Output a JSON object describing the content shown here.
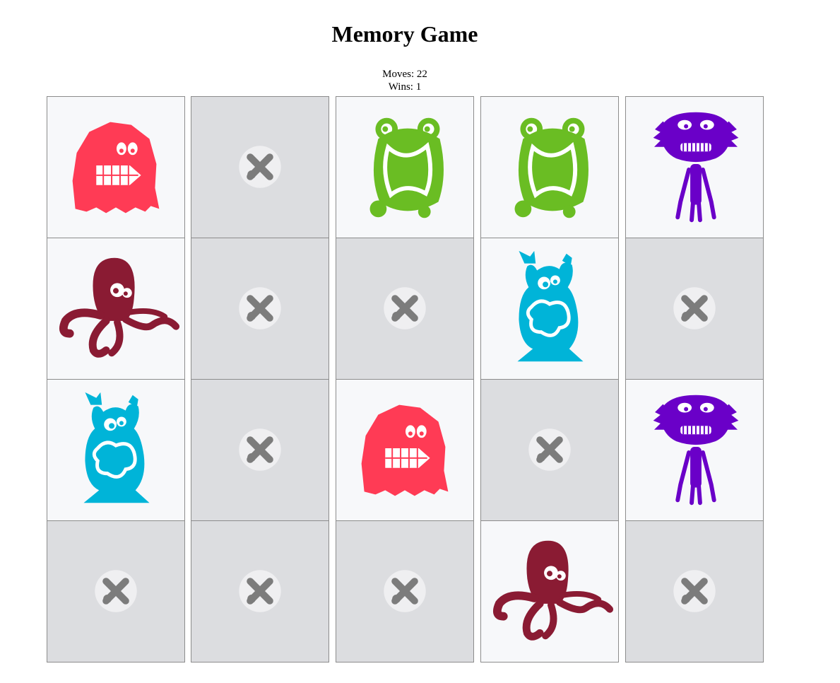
{
  "game": {
    "title": "Memory Game",
    "moves_label": "Moves: 22",
    "wins_label": "Wins: 1"
  },
  "board": {
    "rows": 4,
    "cols": 5,
    "cards": [
      {
        "state": "face-up",
        "monster": "red-furry-monster",
        "color": "#ff3b55"
      },
      {
        "state": "face-down",
        "monster": "card-back",
        "color": "#7c7c7c"
      },
      {
        "state": "face-up",
        "monster": "green-frog-monster",
        "color": "#6abd23"
      },
      {
        "state": "face-up",
        "monster": "green-frog-monster",
        "color": "#6abd23"
      },
      {
        "state": "face-up",
        "monster": "purple-alien-monster",
        "color": "#6a00c8"
      },
      {
        "state": "face-up",
        "monster": "maroon-octopus-monster",
        "color": "#8a1b33"
      },
      {
        "state": "face-down",
        "monster": "card-back",
        "color": "#7c7c7c"
      },
      {
        "state": "face-down",
        "monster": "card-back",
        "color": "#7c7c7c"
      },
      {
        "state": "face-up",
        "monster": "blue-horned-monster",
        "color": "#00b4d8"
      },
      {
        "state": "face-down",
        "monster": "card-back",
        "color": "#7c7c7c"
      },
      {
        "state": "face-up",
        "monster": "blue-horned-monster",
        "color": "#00b4d8"
      },
      {
        "state": "face-down",
        "monster": "card-back",
        "color": "#7c7c7c"
      },
      {
        "state": "face-up",
        "monster": "red-furry-monster",
        "color": "#ff3b55"
      },
      {
        "state": "face-down",
        "monster": "card-back",
        "color": "#7c7c7c"
      },
      {
        "state": "face-up",
        "monster": "purple-alien-monster",
        "color": "#6a00c8"
      },
      {
        "state": "face-down",
        "monster": "card-back",
        "color": "#7c7c7c"
      },
      {
        "state": "face-down",
        "monster": "card-back",
        "color": "#7c7c7c"
      },
      {
        "state": "face-down",
        "monster": "card-back",
        "color": "#7c7c7c"
      },
      {
        "state": "face-up",
        "monster": "maroon-octopus-monster",
        "color": "#8a1b33"
      },
      {
        "state": "face-down",
        "monster": "card-back",
        "color": "#7c7c7c"
      }
    ]
  }
}
